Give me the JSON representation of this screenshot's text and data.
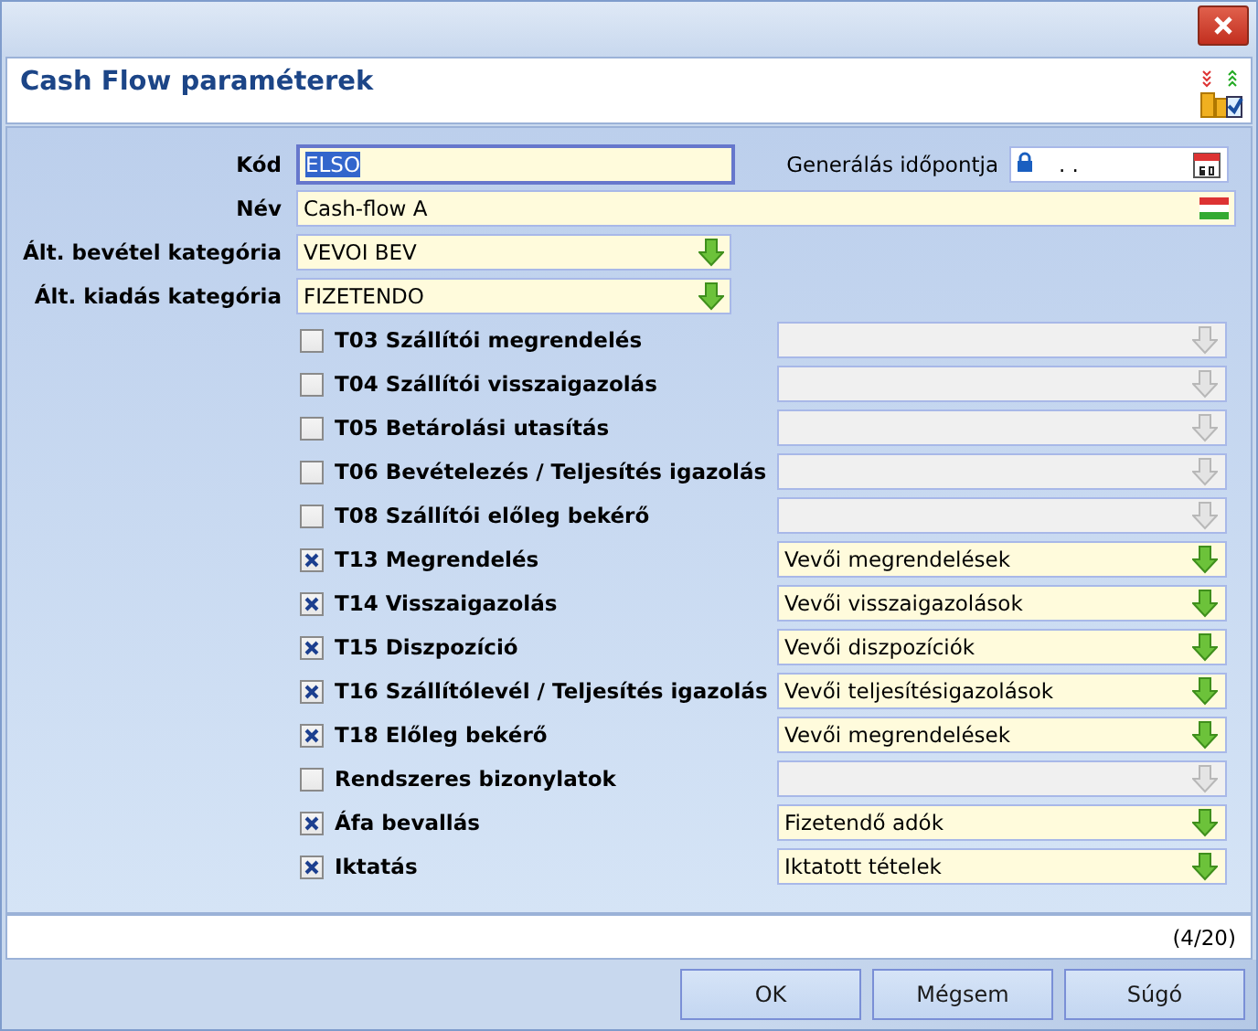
{
  "header": {
    "title": "Cash Flow paraméterek"
  },
  "code": {
    "label": "Kód",
    "value": "ELSO",
    "focused": true
  },
  "generated": {
    "label": "Generálás időpontja",
    "value": ". .",
    "locked": true
  },
  "name": {
    "label": "Név",
    "value": "Cash-flow A"
  },
  "categories": [
    {
      "label": "Ált. bevétel kategória",
      "value": "VEVOI BEV"
    },
    {
      "label": "Ált. kiadás kategória",
      "value": "FIZETENDO"
    }
  ],
  "documents": [
    {
      "label": "T03 Szállítói megrendelés",
      "checked": false
    },
    {
      "label": "T04 Szállítói visszaigazolás",
      "checked": false
    },
    {
      "label": "T05 Betárolási utasítás",
      "checked": false
    },
    {
      "label": "T06 Bevételezés / Teljesítés igazolás",
      "checked": false
    },
    {
      "label": "T08 Szállítói előleg bekérő",
      "checked": false
    },
    {
      "label": "T13 Megrendelés",
      "checked": true,
      "value": "Vevői megrendelések"
    },
    {
      "label": "T14 Visszaigazolás",
      "checked": true,
      "value": "Vevői visszaigazolások"
    },
    {
      "label": "T15 Diszpozíció",
      "checked": true,
      "value": "Vevői diszpozíciók"
    },
    {
      "label": "T16 Szállítólevél / Teljesítés igazolás",
      "checked": true,
      "value": "Vevői teljesítésigazolások"
    },
    {
      "label": "T18 Előleg bekérő",
      "checked": true,
      "value": "Vevői megrendelések"
    },
    {
      "label": "Rendszeres bizonylatok",
      "checked": false
    },
    {
      "label": "Áfa bevallás",
      "checked": true,
      "value": "Fizetendő adók"
    },
    {
      "label": "Iktatás",
      "checked": true,
      "value": "Iktatott tételek"
    }
  ],
  "status": {
    "counter": "(4/20)"
  },
  "buttons": [
    "OK",
    "Mégsem",
    "Súgó"
  ]
}
